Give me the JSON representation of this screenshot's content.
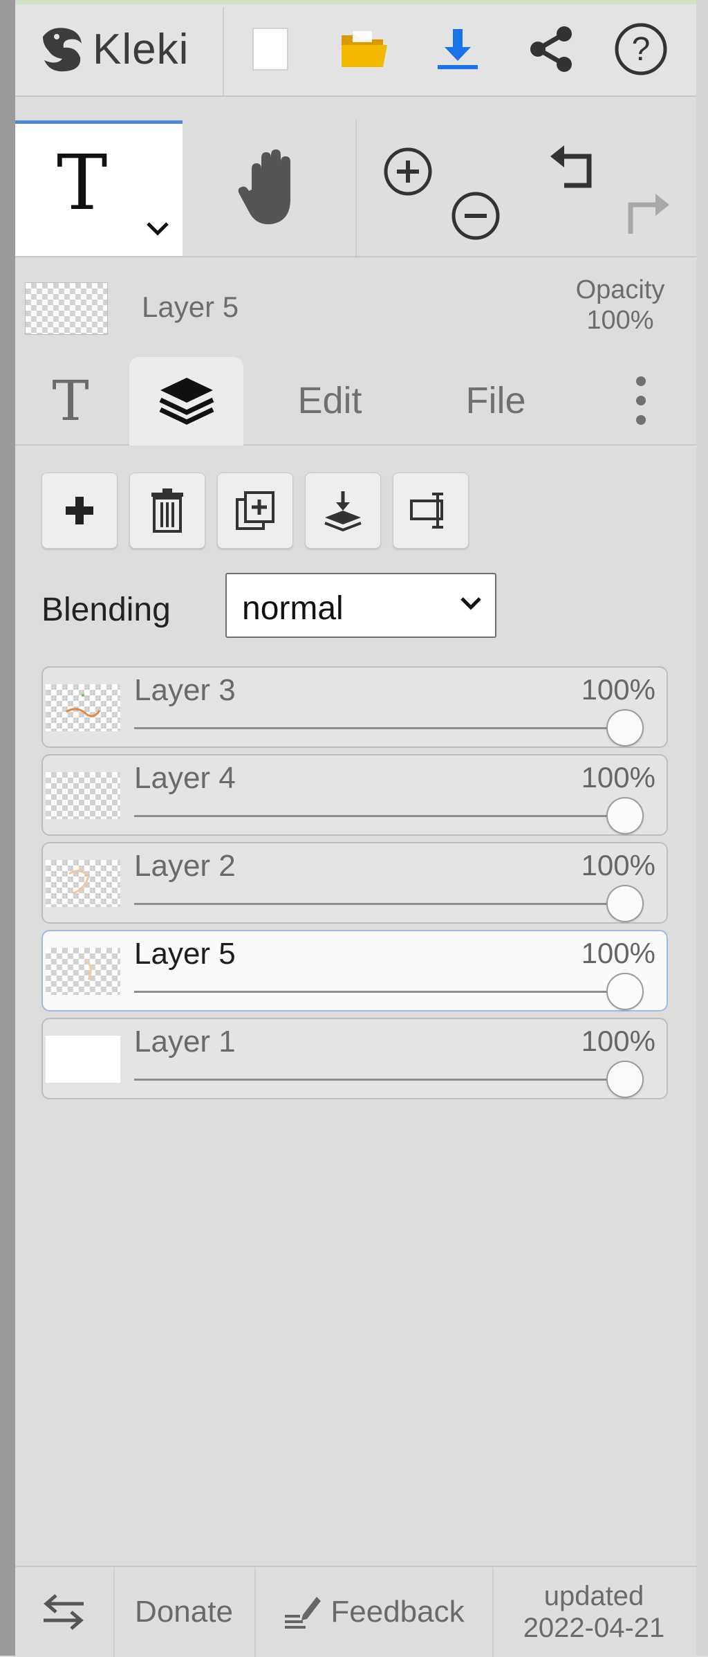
{
  "app": {
    "name": "Kleki"
  },
  "toolbar": {
    "icons": [
      "kleki-logo-icon",
      "new-file-icon",
      "open-folder-icon",
      "download-icon",
      "share-icon",
      "help-icon"
    ],
    "colors": {
      "folder": "#f0b400",
      "download": "#1a73e8"
    }
  },
  "tools": {
    "active": "text",
    "text_glyph": "T",
    "icons": [
      "text-tool-icon",
      "hand-tool-icon",
      "zoom-in-icon",
      "zoom-out-icon",
      "undo-icon",
      "redo-icon"
    ]
  },
  "current_layer": {
    "name": "Layer 5",
    "opacity_label": "Opacity",
    "opacity_value": "100%"
  },
  "tabs": [
    {
      "label": "T",
      "icon": "text-tab-icon"
    },
    {
      "label": "",
      "icon": "layers-icon",
      "active": true
    },
    {
      "label": "Edit"
    },
    {
      "label": "File"
    },
    {
      "label": "",
      "icon": "more-vertical-icon"
    }
  ],
  "layer_actions": [
    "add-layer",
    "delete-layer",
    "duplicate-layer",
    "merge-down",
    "rename-layer"
  ],
  "blending": {
    "label": "Blending",
    "value": "normal"
  },
  "layers": [
    {
      "name": "Layer 3",
      "opacity": "100%",
      "opacity_value": 1.0,
      "active": false,
      "thumb": "transparent-with-sketch"
    },
    {
      "name": "Layer 4",
      "opacity": "100%",
      "opacity_value": 1.0,
      "active": false,
      "thumb": "transparent"
    },
    {
      "name": "Layer 2",
      "opacity": "100%",
      "opacity_value": 1.0,
      "active": false,
      "thumb": "transparent-with-sketch"
    },
    {
      "name": "Layer 5",
      "opacity": "100%",
      "opacity_value": 1.0,
      "active": true,
      "thumb": "transparent-with-sketch"
    },
    {
      "name": "Layer 1",
      "opacity": "100%",
      "opacity_value": 1.0,
      "active": false,
      "thumb": "white"
    }
  ],
  "footer": {
    "donate": "Donate",
    "feedback": "Feedback",
    "updated_label": "updated",
    "updated_date": "2022-04-21"
  }
}
